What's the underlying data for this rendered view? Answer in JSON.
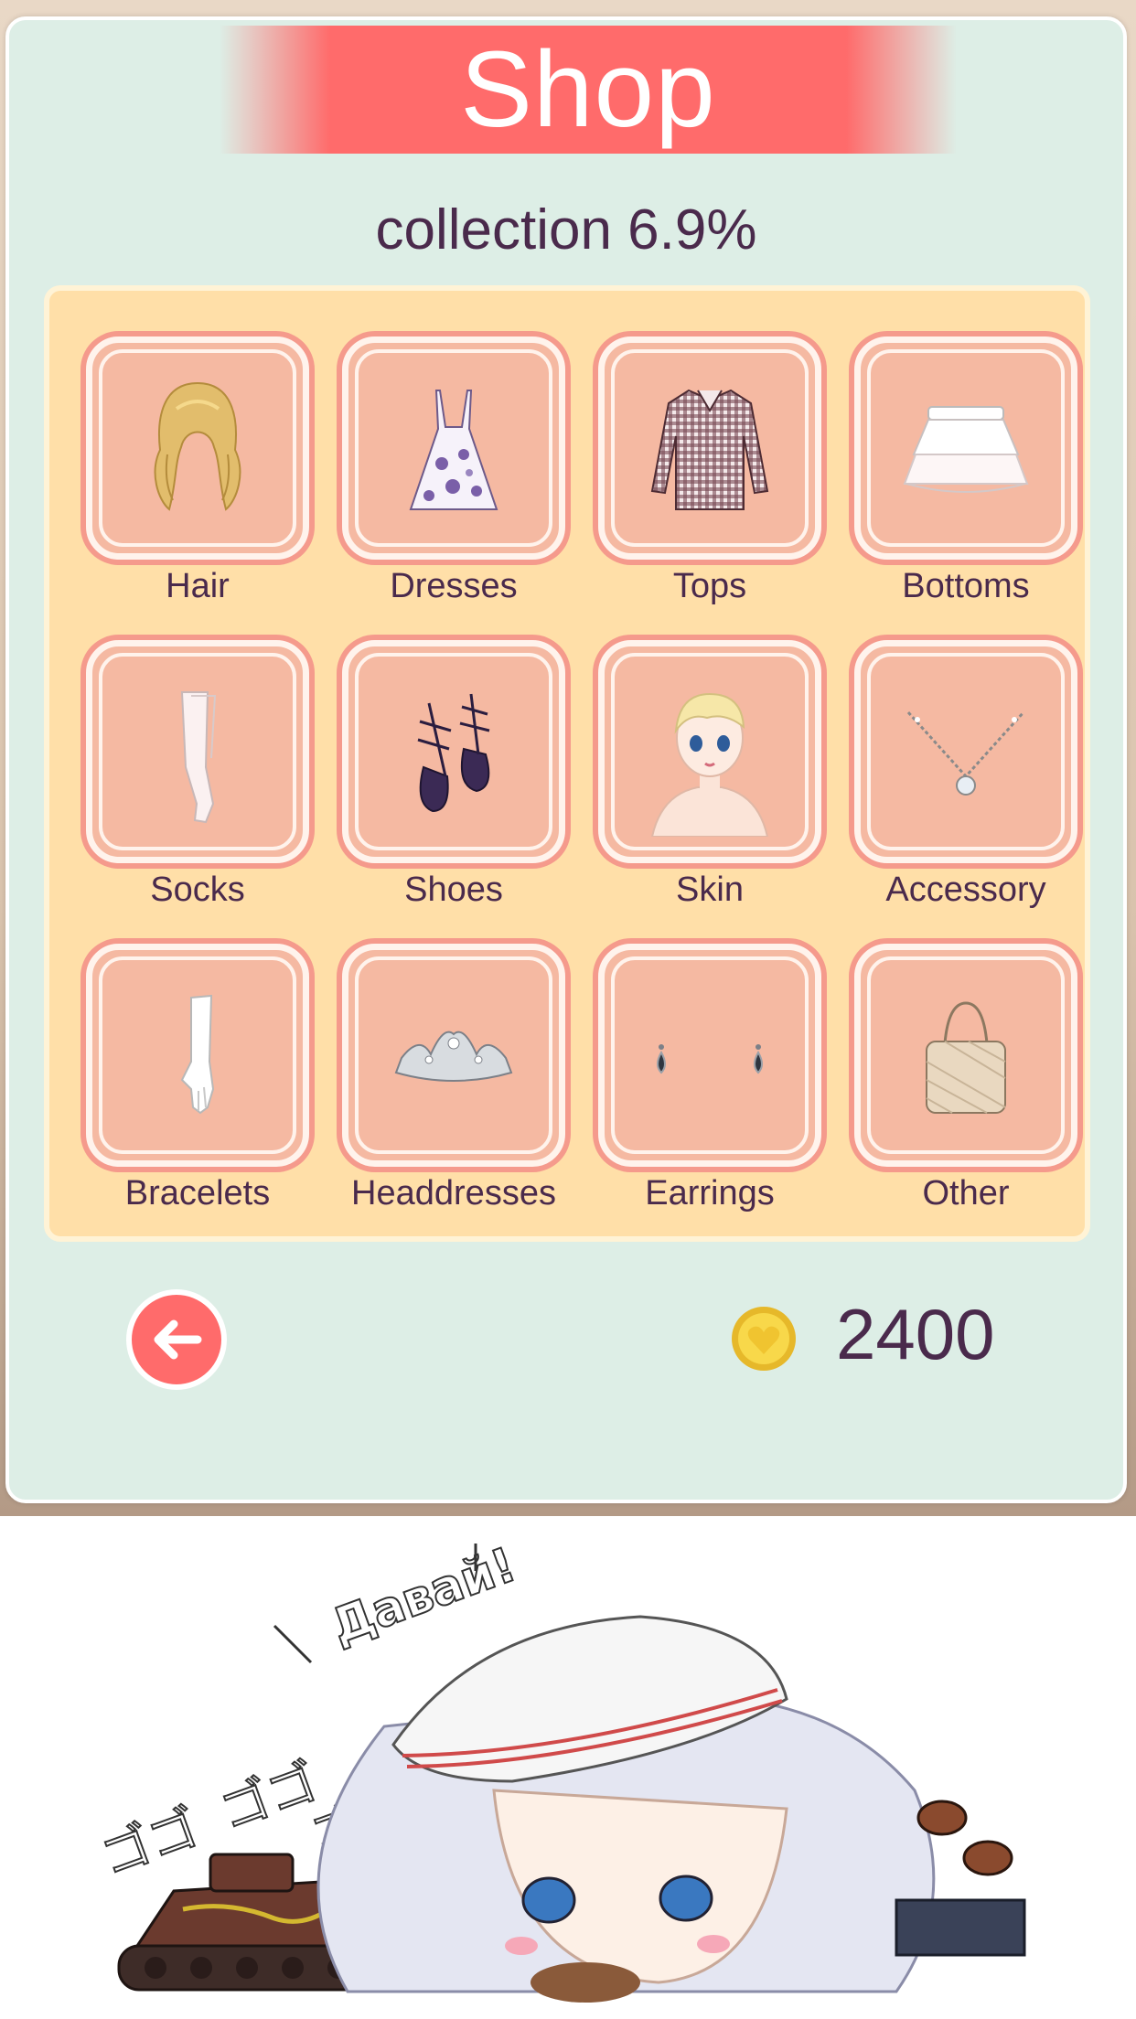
{
  "shop": {
    "title": "Shop",
    "collection": "collection 6.9%",
    "categories": [
      {
        "label": "Hair",
        "icon": "hair-icon"
      },
      {
        "label": "Dresses",
        "icon": "dress-icon"
      },
      {
        "label": "Tops",
        "icon": "shirt-icon"
      },
      {
        "label": "Bottoms",
        "icon": "skirt-icon"
      },
      {
        "label": "Socks",
        "icon": "stockings-icon"
      },
      {
        "label": "Shoes",
        "icon": "shoes-icon"
      },
      {
        "label": "Skin",
        "icon": "face-icon"
      },
      {
        "label": "Accessory",
        "icon": "necklace-icon"
      },
      {
        "label": "Bracelets",
        "icon": "glove-icon"
      },
      {
        "label": "Headdresses",
        "icon": "tiara-icon"
      },
      {
        "label": "Earrings",
        "icon": "earrings-icon"
      },
      {
        "label": "Other",
        "icon": "handbag-icon"
      }
    ],
    "coins": "2400"
  },
  "meme": {
    "shout": "Давай!",
    "sfx_left": "ゴゴ",
    "sfx_mid": "ゴゴ",
    "sfx_right": "ゴ"
  },
  "colors": {
    "panel": "#ddeee6",
    "ribbon": "#ff6b6b",
    "grid": "#ffdfa8",
    "tile": "#f5b9a2",
    "text": "#4a2a4c"
  }
}
